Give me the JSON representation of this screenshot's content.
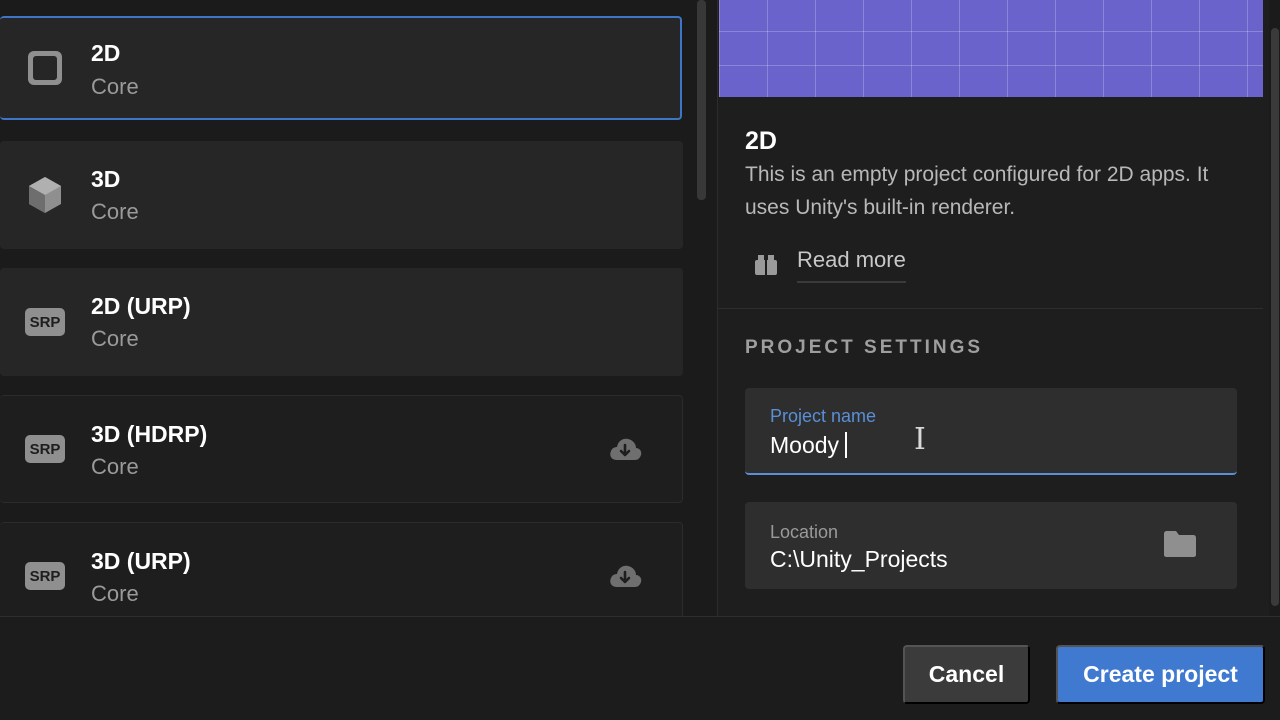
{
  "templates": [
    {
      "title": "2D",
      "subtitle": "Core",
      "icon": "square-outline-icon",
      "selected": true,
      "download": false
    },
    {
      "title": "3D",
      "subtitle": "Core",
      "icon": "cube-icon",
      "selected": false,
      "download": false
    },
    {
      "title": "2D (URP)",
      "subtitle": "Core",
      "icon": "srp-badge-icon",
      "badge": "SRP",
      "selected": false,
      "download": false
    },
    {
      "title": "3D (HDRP)",
      "subtitle": "Core",
      "icon": "srp-badge-icon",
      "badge": "SRP",
      "selected": false,
      "download": true
    },
    {
      "title": "3D (URP)",
      "subtitle": "Core",
      "icon": "srp-badge-icon",
      "badge": "SRP",
      "selected": false,
      "download": true
    }
  ],
  "detail": {
    "title": "2D",
    "description": "This is an empty project configured for 2D apps. It uses Unity's built-in renderer.",
    "read_more": "Read more",
    "read_more_icon": "book-icon",
    "preview_color": "#6b63cc"
  },
  "settings": {
    "heading": "PROJECT SETTINGS",
    "project_name": {
      "label": "Project name",
      "value": "Moody"
    },
    "location": {
      "label": "Location",
      "value": "C:\\Unity_Projects",
      "icon": "folder-icon"
    }
  },
  "footer": {
    "cancel_label": "Cancel",
    "create_label": "Create project"
  },
  "colors": {
    "accent": "#3f7ad0",
    "selected_border": "#3d76c6",
    "background": "#1b1b1b"
  }
}
